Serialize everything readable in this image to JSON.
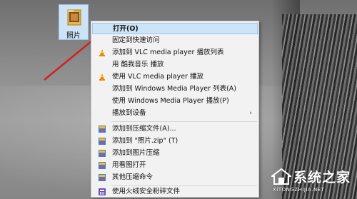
{
  "desktop": {
    "file_label": "照片"
  },
  "menu": {
    "items": [
      {
        "label": "打开(O)",
        "icon": "none"
      },
      {
        "label": "固定到快速访问",
        "icon": "none"
      },
      {
        "label": "添加到 VLC media player 播放列表",
        "icon": "vlc-cone-icon"
      },
      {
        "label": "用 酷我音乐 播放",
        "icon": "none"
      },
      {
        "label": "使用 VLC media player 播放",
        "icon": "vlc-cone-icon"
      },
      {
        "label": "添加到 Windows Media Player 列表(A)",
        "icon": "none"
      },
      {
        "label": "使用 Windows Media Player 播放(P)",
        "icon": "none"
      },
      {
        "label": "播放到设备",
        "icon": "none"
      },
      {
        "label": "添加到压缩文件(A)...",
        "icon": "archive-icon"
      },
      {
        "label": "添加到 \"照片.zip\" (T)",
        "icon": "archive-icon"
      },
      {
        "label": "添加到图片压缩",
        "icon": "archive-icon"
      },
      {
        "label": "用看图打开",
        "icon": "archive-icon"
      },
      {
        "label": "其他压缩命令",
        "icon": "archive-icon"
      },
      {
        "label": "使用火绒安全粉碎文件",
        "icon": "shredder-icon"
      }
    ]
  },
  "watermark": {
    "title": "系统之家",
    "url": "XITONGZHIJIA.NET"
  },
  "colors": {
    "highlight": "#cde4f7",
    "highlight_border": "#99c9ef",
    "arrow": "#d42020",
    "menu_bg": "#f2f2f2",
    "vlc_orange": "#f08a00"
  }
}
